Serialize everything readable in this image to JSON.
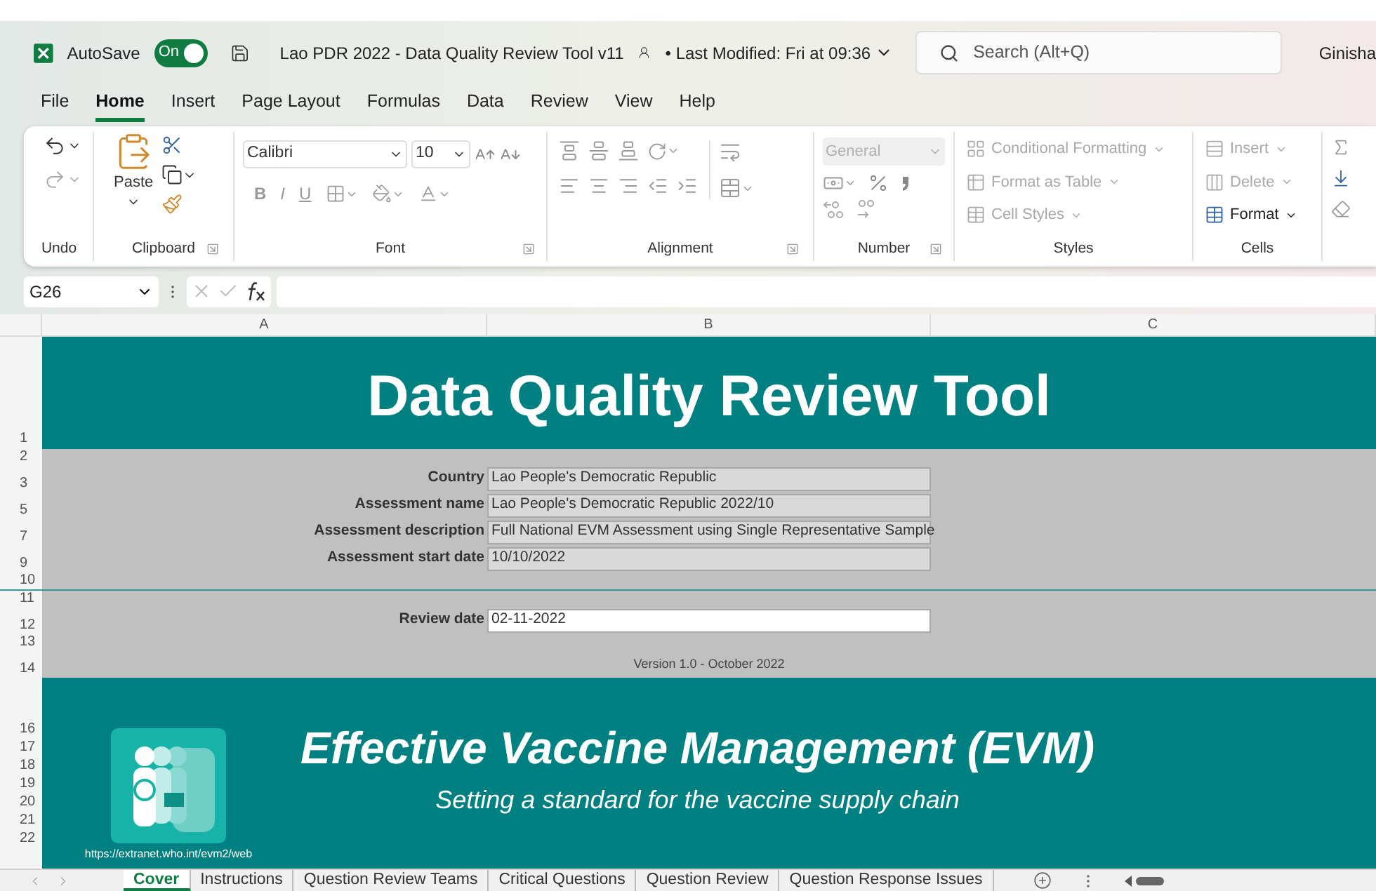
{
  "title_bar": {
    "autosave_label": "AutoSave",
    "autosave": {
      "label": "On",
      "on": true
    },
    "document_title": "Lao PDR 2022 - Data Quality Review Tool v11",
    "last_modified": "• Last Modified: Fri at 09:36",
    "search": {
      "placeholder": "Search (Alt+Q)"
    },
    "user": "Ginisha"
  },
  "menu_tabs": [
    {
      "label": "File",
      "selected": false
    },
    {
      "label": "Home",
      "selected": true
    },
    {
      "label": "Insert",
      "selected": false
    },
    {
      "label": "Page Layout",
      "selected": false
    },
    {
      "label": "Formulas",
      "selected": false
    },
    {
      "label": "Data",
      "selected": false
    },
    {
      "label": "Review",
      "selected": false
    },
    {
      "label": "View",
      "selected": false
    },
    {
      "label": "Help",
      "selected": false
    }
  ],
  "ribbon": {
    "undo": {
      "label": "Undo"
    },
    "clipboard": {
      "paste": "Paste",
      "label": "Clipboard"
    },
    "font": {
      "name": "Calibri",
      "size": "10",
      "style_buttons": [
        "B",
        "I",
        "U"
      ],
      "label": "Font"
    },
    "alignment": {
      "label": "Alignment"
    },
    "number": {
      "format": {
        "value": "General",
        "disabled": true
      },
      "label": "Number"
    },
    "styles": {
      "items": [
        {
          "label": "Conditional Formatting",
          "disabled": true
        },
        {
          "label": "Format as Table",
          "disabled": true
        },
        {
          "label": "Cell Styles",
          "disabled": true
        }
      ],
      "label": "Styles"
    },
    "cells": {
      "items": [
        {
          "label": "Insert",
          "disabled": true
        },
        {
          "label": "Delete",
          "disabled": true
        },
        {
          "label": "Format",
          "disabled": false
        }
      ],
      "label": "Cells"
    }
  },
  "formula_bar": {
    "name_box": "G26"
  },
  "columns": [
    "A",
    "B",
    "C"
  ],
  "sheet": {
    "title_row": {
      "number": "1",
      "title": "Data Quality Review Tool"
    },
    "details": [
      {
        "number": "2"
      },
      {
        "number": "3",
        "label": "Country",
        "value": "Lao People's Democratic Republic"
      },
      {
        "number": "5",
        "label": "Assessment name",
        "value": "Lao People's Democratic Republic 2022/10"
      },
      {
        "number": "7",
        "label": "Assessment description",
        "value": "Full National EVM Assessment using Single Representative Sample"
      },
      {
        "number": "9",
        "label": "Assessment start date",
        "value": "10/10/2022"
      },
      {
        "number": "10"
      }
    ],
    "review": [
      {
        "number": "11"
      },
      {
        "number": "12",
        "label": "Review date",
        "value": "02-11-2022"
      },
      {
        "number": "13"
      },
      {
        "number": "14",
        "note": "Version 1.0 - October 2022"
      }
    ],
    "banner": {
      "row_numbers": [
        "16",
        "17",
        "18",
        "19",
        "20",
        "21",
        "22"
      ],
      "heading": "Effective Vaccine Management (EVM)",
      "subheading": "Setting a standard for the vaccine supply chain",
      "url": "https://extranet.who.int/evm2/web"
    }
  },
  "sheet_tabs": [
    {
      "label": "Cover",
      "selected": true
    },
    {
      "label": "Instructions",
      "selected": false
    },
    {
      "label": "Question Review Teams",
      "selected": false
    },
    {
      "label": "Critical Questions",
      "selected": false
    },
    {
      "label": "Question Review",
      "selected": false
    },
    {
      "label": "Question Response Issues",
      "selected": false
    }
  ]
}
